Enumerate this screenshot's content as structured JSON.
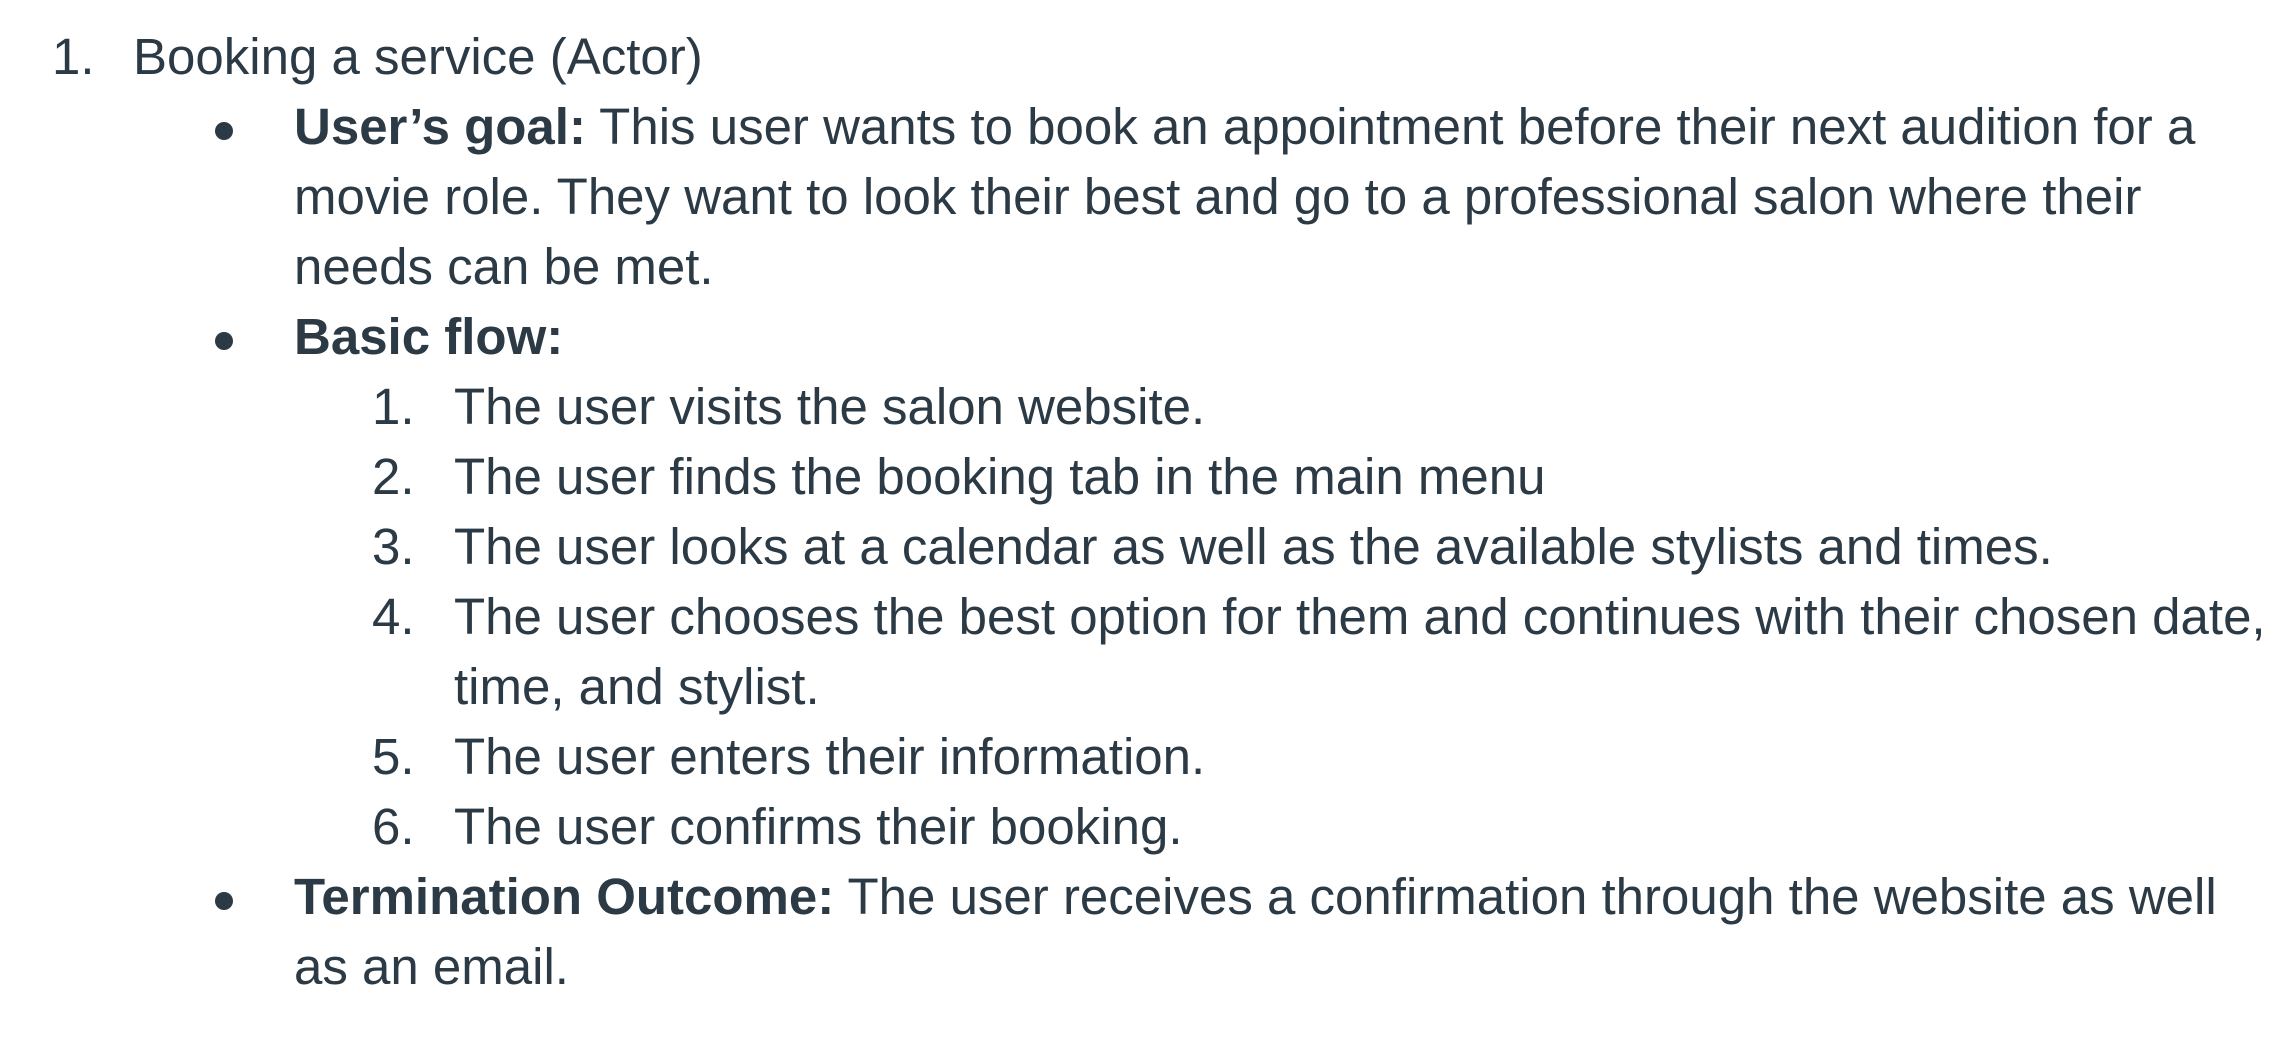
{
  "list": {
    "item1": {
      "number": "1.",
      "text": "Booking a service (Actor)"
    },
    "goal": {
      "label": "User’s goal:",
      "text": " This user wants to book an appointment before their next audition for a movie role. They want to look their best and go to a professional salon where their needs can be met."
    },
    "flow": {
      "label": "Basic flow:",
      "steps": [
        {
          "number": "1.",
          "text": "The user visits the salon website."
        },
        {
          "number": "2.",
          "text": "The user finds the booking tab in the main menu"
        },
        {
          "number": "3.",
          "text": "The user looks at a calendar as well as the available stylists and times."
        },
        {
          "number": "4.",
          "text": "The user chooses the best option for them and continues with their chosen date, time, and stylist."
        },
        {
          "number": "5.",
          "text": "The user enters their information."
        },
        {
          "number": "6.",
          "text": "The user confirms their booking."
        }
      ]
    },
    "outcome": {
      "label": "Termination Outcome:",
      "text": " The user receives a confirmation through the website as well as an email."
    }
  }
}
